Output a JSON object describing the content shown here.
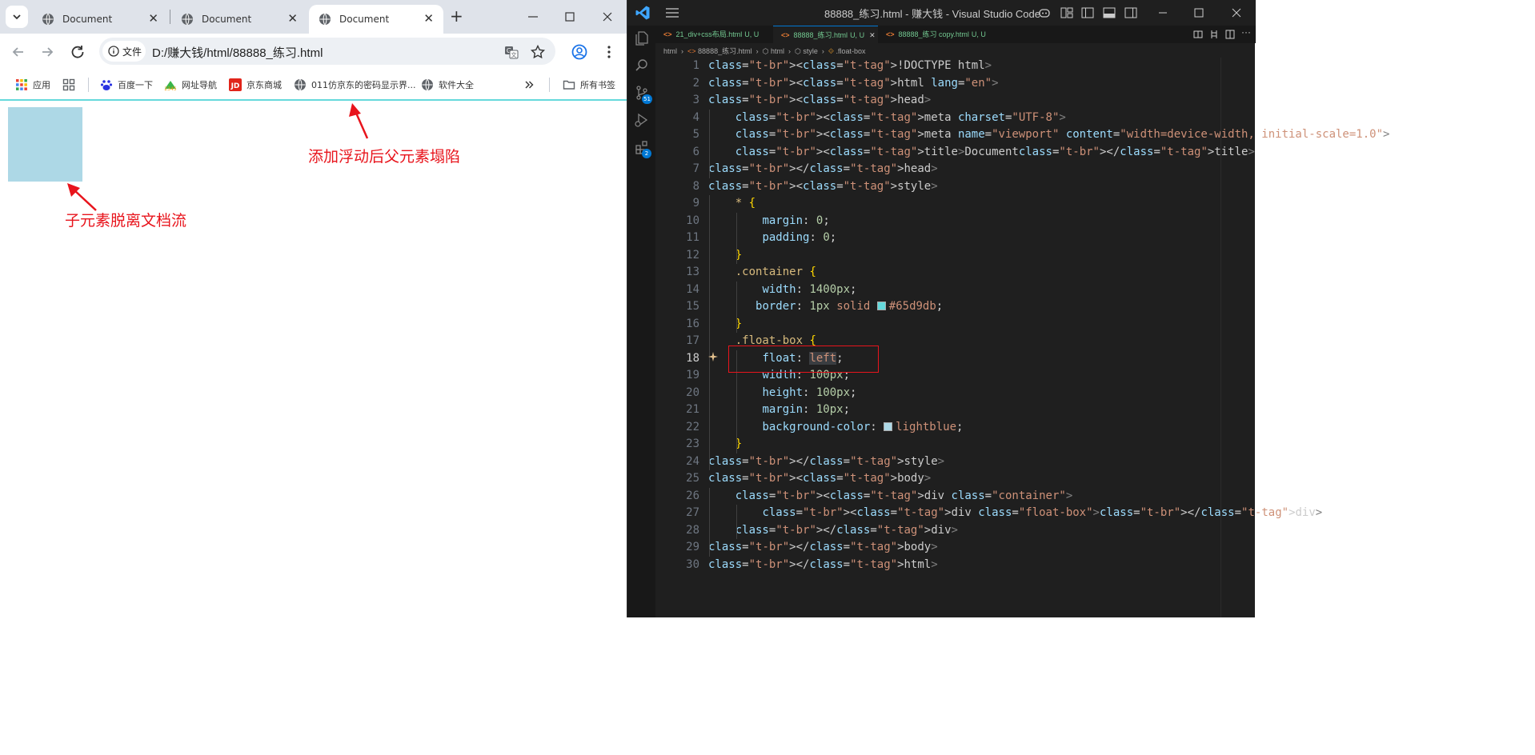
{
  "browser": {
    "tabs": [
      {
        "title": "Document",
        "active": false
      },
      {
        "title": "Document",
        "active": false
      },
      {
        "title": "Document",
        "active": true
      }
    ],
    "address_chip": "文件",
    "url": "D:/赚大钱/html/88888_练习.html",
    "bookmarks": [
      {
        "label": "应用",
        "icon": "apps-grid-icon"
      },
      {
        "label": "",
        "icon": "tab-groups-icon"
      },
      {
        "label": "百度一下",
        "icon": "baidu-icon"
      },
      {
        "label": "网址导航",
        "icon": "2345-icon"
      },
      {
        "label": "京东商城",
        "icon": "jd-icon"
      },
      {
        "label": "011仿京东的密码显示界...",
        "icon": "globe-icon"
      },
      {
        "label": "软件大全",
        "icon": "globe-icon"
      }
    ],
    "all_bookmarks": "所有书签",
    "page": {
      "annotation_top": "添加浮动后父元素塌陷",
      "annotation_left": "子元素脱离文档流",
      "container_border_color": "#65d9db",
      "box_color": "lightblue",
      "annotation_color": "#e8141c"
    }
  },
  "vscode": {
    "window_title": "88888_练习.html - 赚大钱 - Visual Studio Code",
    "tabs": [
      {
        "name": "21_div+css布局.html",
        "status": "U, U",
        "active": false
      },
      {
        "name": "88888_练习.html",
        "status": "U, U",
        "active": true
      },
      {
        "name": "88888_练习 copy.html",
        "status": "U, U",
        "active": false
      }
    ],
    "breadcrumb": [
      "html",
      "88888_练习.html",
      "html",
      "style",
      ".float-box"
    ],
    "badges": {
      "source_control": "51",
      "extensions": "2"
    },
    "current_line": "18",
    "code_lines": [
      "<!DOCTYPE html>",
      "<html lang=\"en\">",
      "<head>",
      "    <meta charset=\"UTF-8\">",
      "    <meta name=\"viewport\" content=\"width=device-width, initial-scale=1.0\">",
      "    <title>Document</title>",
      "</head>",
      "<style>",
      "    * {",
      "        margin: 0;",
      "        padding: 0;",
      "    }",
      "    .container {",
      "        width: 1400px;",
      "       border: 1px solid #65d9db;",
      "    }",
      "    .float-box {",
      "        float: left;",
      "        width: 100px;",
      "        height: 100px;",
      "        margin: 10px;",
      "        background-color: lightblue;",
      "    }",
      "</style>",
      "<body>",
      "    <div class=\"container\">",
      "        <div class=\"float-box\"></div>",
      "    </div>",
      "</body>",
      "</html>"
    ]
  }
}
